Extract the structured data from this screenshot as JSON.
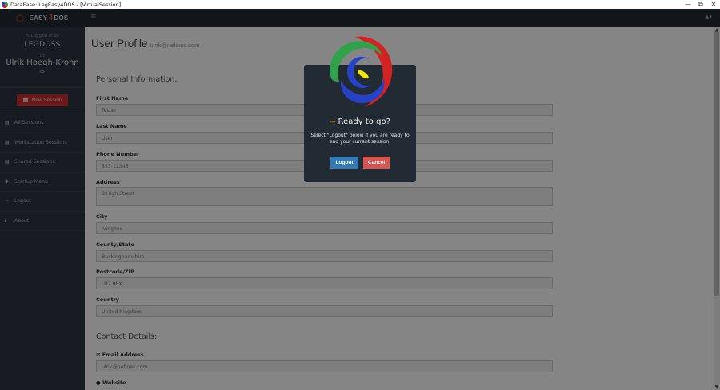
{
  "window": {
    "title": "DataEase: LegEasy4DOS - [VirtualSession]",
    "controls": [
      "—",
      "⧉",
      "✕"
    ]
  },
  "navbar": {
    "brand_left": "EASY",
    "brand_num": "4",
    "brand_right": "DOS",
    "hamburger": "≡",
    "user_menu": "▲▾"
  },
  "sidebar": {
    "logged_in_label": "✎ Logged in as",
    "company": "LEGDOSS",
    "as_label": "as",
    "username": "Ulrik Hoegh-Krohn",
    "logout_glyph": "⇨",
    "new_session_label": "New Session",
    "items": [
      {
        "icon": "▤",
        "label": "All Sessions"
      },
      {
        "icon": "▤",
        "label": "Workstation Sessions"
      },
      {
        "icon": "▤",
        "label": "Shared Sessions"
      },
      {
        "icon": "✱",
        "label": "Startup Menu"
      },
      {
        "icon": "⇨",
        "label": "Logout"
      },
      {
        "icon": "ℹ",
        "label": "About"
      }
    ]
  },
  "main": {
    "title": "User Profile",
    "subtitle": "ulrik@nefines.com",
    "personal_header": "Personal Information:",
    "contact_header": "Contact Details:",
    "fields": {
      "first_name": {
        "label": "First Name",
        "value": "Tester"
      },
      "last_name": {
        "label": "Last Name",
        "value": "User"
      },
      "phone": {
        "label": "Phone Number",
        "value": "555-12345"
      },
      "address": {
        "label": "Address",
        "value": "8 High Street"
      },
      "city": {
        "label": "City",
        "value": "Ivinghoe"
      },
      "county": {
        "label": "County/State",
        "value": "Buckinghamshire"
      },
      "postcode": {
        "label": "Postcode/ZIP",
        "value": "LU7 9EX"
      },
      "country": {
        "label": "Country",
        "value": "United Kingdom"
      },
      "email": {
        "label": "Email Address",
        "value": "ulrik@nefines.com"
      },
      "website": {
        "label": "Website"
      }
    },
    "email_icon": "✉",
    "website_icon": "●"
  },
  "modal": {
    "title": "Ready to go?",
    "title_icon": "⇨",
    "body": "Select \"Logout\" below if you are ready to end your current session.",
    "logout_label": "Logout",
    "cancel_label": "Cancel"
  },
  "colors": {
    "navbar": "#222b33",
    "sidebar": "#2b3640",
    "new_session": "#c9302c",
    "logout_btn": "#337ab7",
    "cancel_btn": "#d9534f",
    "logo_green": "#2fa24a",
    "logo_red": "#d22222",
    "logo_blue": "#2643c8",
    "logo_yellow": "#f2e600"
  }
}
